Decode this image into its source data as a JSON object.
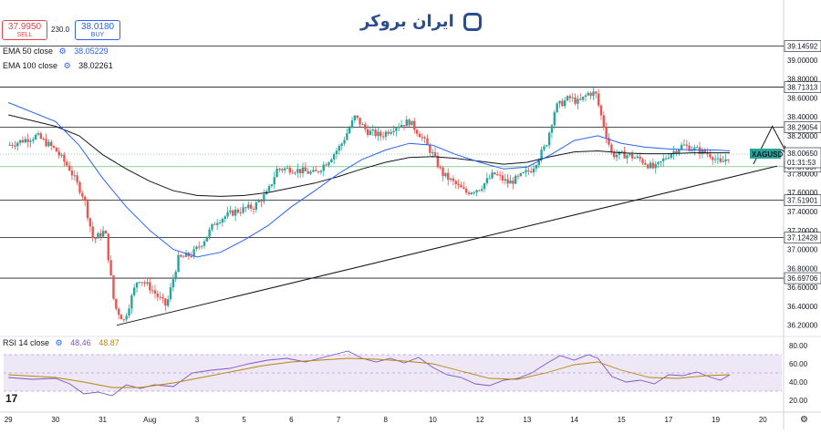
{
  "order_panel": {
    "sell": {
      "price": "37.9950",
      "label": "SELL"
    },
    "spread": "230.0",
    "buy": {
      "price": "38.0180",
      "label": "BUY"
    }
  },
  "indicators": {
    "ema50": {
      "label": "EMA 50 close",
      "value": "38.05229",
      "color": "#2962ff"
    },
    "ema100": {
      "label": "EMA 100 close",
      "value": "38.02261",
      "color": "#131722"
    },
    "rsi": {
      "label": "RSI 14 close",
      "value1": "48.46",
      "value2": "48.87",
      "rsi_color": "#7e57c2",
      "ma_color": "#b8860b"
    }
  },
  "logo": {
    "text": "ایران بروکر"
  },
  "branding": {
    "tv_logo": "17"
  },
  "colors": {
    "up": "#26a69a",
    "down": "#ef5350",
    "level_line": "#131722",
    "trend_line": "#131722",
    "price_line": "#4caf50",
    "rsi_band": "#ede7f6"
  },
  "chart_data": [
    {
      "type": "candlestick",
      "symbol": "XAGUSD",
      "ylim": [
        36.12,
        39.2
      ],
      "y_ticks": [
        "39.00000",
        "38.80000",
        "38.60000",
        "38.40000",
        "38.20000",
        "38.00000",
        "37.80000",
        "37.60000",
        "37.40000",
        "37.20000",
        "37.00000",
        "36.80000",
        "36.60000",
        "36.40000",
        "36.20000"
      ],
      "x_ticks": [
        {
          "label": "29",
          "x": 0
        },
        {
          "label": "30",
          "x": 1
        },
        {
          "label": "31",
          "x": 2
        },
        {
          "label": "Aug",
          "x": 3
        },
        {
          "label": "3",
          "x": 4
        },
        {
          "label": "5",
          "x": 5
        },
        {
          "label": "6",
          "x": 6
        },
        {
          "label": "7",
          "x": 7
        },
        {
          "label": "8",
          "x": 8
        },
        {
          "label": "10",
          "x": 9
        },
        {
          "label": "12",
          "x": 10
        },
        {
          "label": "13",
          "x": 11
        },
        {
          "label": "14",
          "x": 12
        },
        {
          "label": "15",
          "x": 13
        },
        {
          "label": "17",
          "x": 14
        },
        {
          "label": "19",
          "x": 15
        },
        {
          "label": "20",
          "x": 16
        }
      ],
      "xlim": [
        -0.1,
        16.4
      ],
      "levels": [
        "39.14592",
        "38.71313",
        "38.29054",
        "37.51901",
        "37.12428",
        "36.69706"
      ],
      "current_price": {
        "symbol": "XAGUSD",
        "price": "38.00650",
        "countdown": "01:31:53"
      },
      "price_line": "37.87357",
      "trendline": {
        "start": [
          2.3,
          36.2
        ],
        "end": [
          16.3,
          37.88
        ]
      },
      "arrow_path": [
        [
          15.8,
          37.9
        ],
        [
          16.2,
          38.3
        ],
        [
          16.5,
          38.02
        ]
      ],
      "price_path": [
        [
          0,
          38.1
        ],
        [
          0.6,
          38.2
        ],
        [
          1.0,
          38.05
        ],
        [
          1.3,
          37.85
        ],
        [
          1.6,
          37.55
        ],
        [
          1.8,
          37.1
        ],
        [
          2.05,
          37.2
        ],
        [
          2.25,
          36.4
        ],
        [
          2.45,
          36.25
        ],
        [
          2.75,
          36.7
        ],
        [
          3.0,
          36.6
        ],
        [
          3.35,
          36.4
        ],
        [
          3.6,
          36.9
        ],
        [
          3.9,
          36.95
        ],
        [
          4.15,
          37.1
        ],
        [
          4.4,
          37.3
        ],
        [
          4.8,
          37.4
        ],
        [
          5.2,
          37.45
        ],
        [
          5.5,
          37.6
        ],
        [
          5.7,
          37.85
        ],
        [
          6.0,
          37.85
        ],
        [
          6.5,
          37.8
        ],
        [
          6.8,
          37.95
        ],
        [
          7.05,
          38.1
        ],
        [
          7.35,
          38.4
        ],
        [
          7.6,
          38.25
        ],
        [
          7.9,
          38.2
        ],
        [
          8.2,
          38.3
        ],
        [
          8.5,
          38.35
        ],
        [
          8.75,
          38.2
        ],
        [
          9.0,
          38.0
        ],
        [
          9.2,
          37.8
        ],
        [
          9.45,
          37.7
        ],
        [
          9.7,
          37.6
        ],
        [
          10.0,
          37.65
        ],
        [
          10.3,
          37.8
        ],
        [
          10.6,
          37.7
        ],
        [
          10.8,
          37.75
        ],
        [
          11.1,
          37.85
        ],
        [
          11.4,
          38.1
        ],
        [
          11.6,
          38.5
        ],
        [
          11.9,
          38.6
        ],
        [
          12.1,
          38.55
        ],
        [
          12.3,
          38.65
        ],
        [
          12.45,
          38.65
        ],
        [
          12.6,
          38.35
        ],
        [
          12.8,
          38.0
        ],
        [
          13.1,
          38.0
        ],
        [
          13.4,
          37.95
        ],
        [
          13.7,
          37.85
        ],
        [
          14.0,
          38.0
        ],
        [
          14.3,
          38.1
        ],
        [
          14.6,
          38.05
        ],
        [
          14.9,
          38.0
        ],
        [
          15.1,
          37.9
        ],
        [
          15.3,
          38.0
        ]
      ],
      "ema50": [
        [
          0,
          38.55
        ],
        [
          1.0,
          38.35
        ],
        [
          1.5,
          38.1
        ],
        [
          2.0,
          37.75
        ],
        [
          2.5,
          37.45
        ],
        [
          3.0,
          37.2
        ],
        [
          3.5,
          37.0
        ],
        [
          4.0,
          36.92
        ],
        [
          4.5,
          36.97
        ],
        [
          5.0,
          37.1
        ],
        [
          5.5,
          37.25
        ],
        [
          6.0,
          37.45
        ],
        [
          6.5,
          37.62
        ],
        [
          7.0,
          37.8
        ],
        [
          7.5,
          37.95
        ],
        [
          8.0,
          38.05
        ],
        [
          8.5,
          38.12
        ],
        [
          9.0,
          38.1
        ],
        [
          9.5,
          38.0
        ],
        [
          10.0,
          37.92
        ],
        [
          10.5,
          37.85
        ],
        [
          11.0,
          37.87
        ],
        [
          11.5,
          38.0
        ],
        [
          12.0,
          38.15
        ],
        [
          12.5,
          38.2
        ],
        [
          13.0,
          38.12
        ],
        [
          13.5,
          38.08
        ],
        [
          14.0,
          38.06
        ],
        [
          14.5,
          38.05
        ],
        [
          15.0,
          38.05
        ],
        [
          15.3,
          38.04
        ]
      ],
      "ema100": [
        [
          0,
          38.42
        ],
        [
          1.0,
          38.3
        ],
        [
          1.5,
          38.2
        ],
        [
          2.0,
          38.0
        ],
        [
          2.5,
          37.85
        ],
        [
          3.0,
          37.72
        ],
        [
          3.5,
          37.62
        ],
        [
          4.0,
          37.57
        ],
        [
          4.5,
          37.56
        ],
        [
          5.0,
          37.57
        ],
        [
          5.5,
          37.6
        ],
        [
          6.0,
          37.65
        ],
        [
          6.5,
          37.7
        ],
        [
          7.0,
          37.77
        ],
        [
          7.5,
          37.85
        ],
        [
          8.0,
          37.92
        ],
        [
          8.5,
          37.97
        ],
        [
          9.0,
          37.98
        ],
        [
          9.5,
          37.96
        ],
        [
          10.0,
          37.93
        ],
        [
          10.5,
          37.9
        ],
        [
          11.0,
          37.92
        ],
        [
          11.5,
          37.98
        ],
        [
          12.0,
          38.03
        ],
        [
          12.5,
          38.04
        ],
        [
          13.0,
          38.02
        ],
        [
          13.5,
          38.01
        ],
        [
          14.0,
          38.01
        ],
        [
          14.5,
          38.02
        ],
        [
          15.0,
          38.02
        ],
        [
          15.3,
          38.02
        ]
      ]
    },
    {
      "type": "line",
      "name": "RSI 14 close",
      "ylim": [
        11,
        84
      ],
      "y_ticks": [
        "80.00",
        "60.00",
        "40.00",
        "20.00"
      ],
      "band": [
        30,
        70
      ],
      "xlim": [
        -0.1,
        16.4
      ],
      "series": [
        {
          "values": [
            [
              0,
              45
            ],
            [
              0.5,
              43
            ],
            [
              1.0,
              44
            ],
            [
              1.3,
              38
            ],
            [
              1.6,
              27
            ],
            [
              1.9,
              29
            ],
            [
              2.2,
              25
            ],
            [
              2.5,
              37
            ],
            [
              2.8,
              33
            ],
            [
              3.1,
              37
            ],
            [
              3.5,
              35
            ],
            [
              3.9,
              50
            ],
            [
              4.3,
              53
            ],
            [
              4.7,
              55
            ],
            [
              5.1,
              60
            ],
            [
              5.5,
              64
            ],
            [
              5.9,
              66
            ],
            [
              6.3,
              62
            ],
            [
              6.6,
              66
            ],
            [
              6.9,
              70
            ],
            [
              7.2,
              74
            ],
            [
              7.5,
              66
            ],
            [
              7.8,
              62
            ],
            [
              8.1,
              66
            ],
            [
              8.4,
              61
            ],
            [
              8.7,
              67
            ],
            [
              9.0,
              56
            ],
            [
              9.3,
              48
            ],
            [
              9.6,
              45
            ],
            [
              9.9,
              38
            ],
            [
              10.2,
              36
            ],
            [
              10.5,
              42
            ],
            [
              10.8,
              44
            ],
            [
              11.1,
              50
            ],
            [
              11.4,
              60
            ],
            [
              11.7,
              69
            ],
            [
              12.0,
              64
            ],
            [
              12.3,
              70
            ],
            [
              12.5,
              66
            ],
            [
              12.8,
              46
            ],
            [
              13.1,
              40
            ],
            [
              13.4,
              42
            ],
            [
              13.7,
              38
            ],
            [
              14.0,
              48
            ],
            [
              14.3,
              47
            ],
            [
              14.6,
              51
            ],
            [
              14.9,
              45
            ],
            [
              15.1,
              42
            ],
            [
              15.3,
              48
            ]
          ]
        },
        {
          "values": [
            [
              0,
              48
            ],
            [
              1.0,
              45
            ],
            [
              1.6,
              40
            ],
            [
              2.2,
              34
            ],
            [
              2.8,
              34
            ],
            [
              3.5,
              39
            ],
            [
              4.2,
              46
            ],
            [
              4.8,
              52
            ],
            [
              5.4,
              58
            ],
            [
              6.0,
              62
            ],
            [
              6.6,
              64
            ],
            [
              7.2,
              66
            ],
            [
              7.8,
              65
            ],
            [
              8.4,
              63
            ],
            [
              9.0,
              60
            ],
            [
              9.6,
              52
            ],
            [
              10.2,
              44
            ],
            [
              10.8,
              43
            ],
            [
              11.4,
              50
            ],
            [
              12.0,
              59
            ],
            [
              12.5,
              62
            ],
            [
              13.0,
              53
            ],
            [
              13.6,
              45
            ],
            [
              14.2,
              44
            ],
            [
              14.8,
              47
            ],
            [
              15.3,
              48
            ]
          ]
        }
      ]
    }
  ]
}
